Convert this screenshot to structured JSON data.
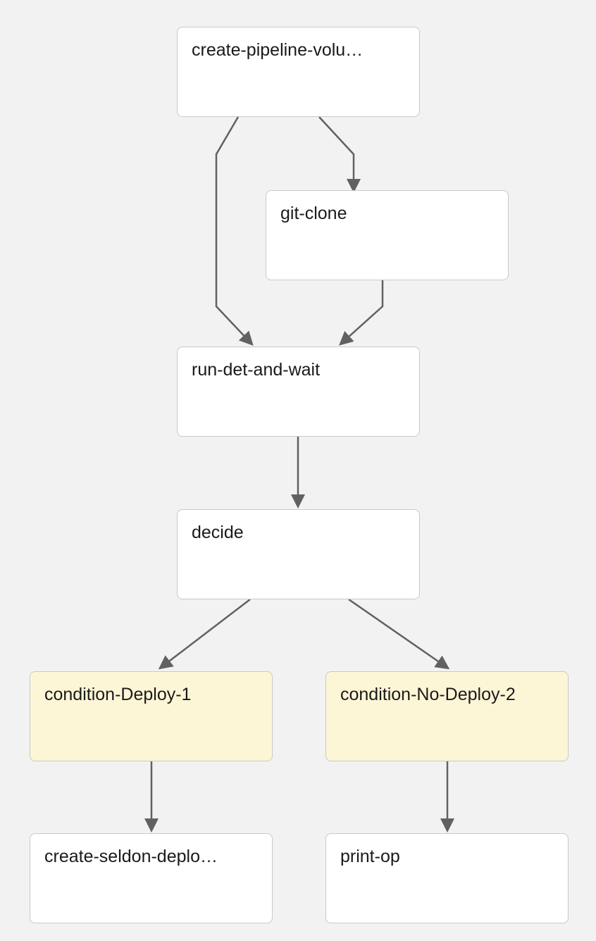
{
  "nodes": {
    "create_pipeline_volume": {
      "label": "create-pipeline-volu…",
      "type": "step"
    },
    "git_clone": {
      "label": "git-clone",
      "type": "step"
    },
    "run_det_and_wait": {
      "label": "run-det-and-wait",
      "type": "step"
    },
    "decide": {
      "label": "decide",
      "type": "step"
    },
    "condition_deploy_1": {
      "label": "condition-Deploy-1",
      "type": "condition"
    },
    "condition_no_deploy_2": {
      "label": "condition-No-Deploy-2",
      "type": "condition"
    },
    "create_seldon_deploy": {
      "label": "create-seldon-deplo…",
      "type": "step"
    },
    "print_op": {
      "label": "print-op",
      "type": "step"
    }
  },
  "edges": [
    {
      "from": "create_pipeline_volume",
      "to": "git_clone"
    },
    {
      "from": "create_pipeline_volume",
      "to": "run_det_and_wait"
    },
    {
      "from": "git_clone",
      "to": "run_det_and_wait"
    },
    {
      "from": "run_det_and_wait",
      "to": "decide"
    },
    {
      "from": "decide",
      "to": "condition_deploy_1"
    },
    {
      "from": "decide",
      "to": "condition_no_deploy_2"
    },
    {
      "from": "condition_deploy_1",
      "to": "create_seldon_deploy"
    },
    {
      "from": "condition_no_deploy_2",
      "to": "print_op"
    }
  ],
  "colors": {
    "node_bg": "#ffffff",
    "condition_bg": "#fdf6d6",
    "border": "#c9c9c9",
    "edge": "#616161",
    "canvas_bg": "#f2f2f2"
  }
}
